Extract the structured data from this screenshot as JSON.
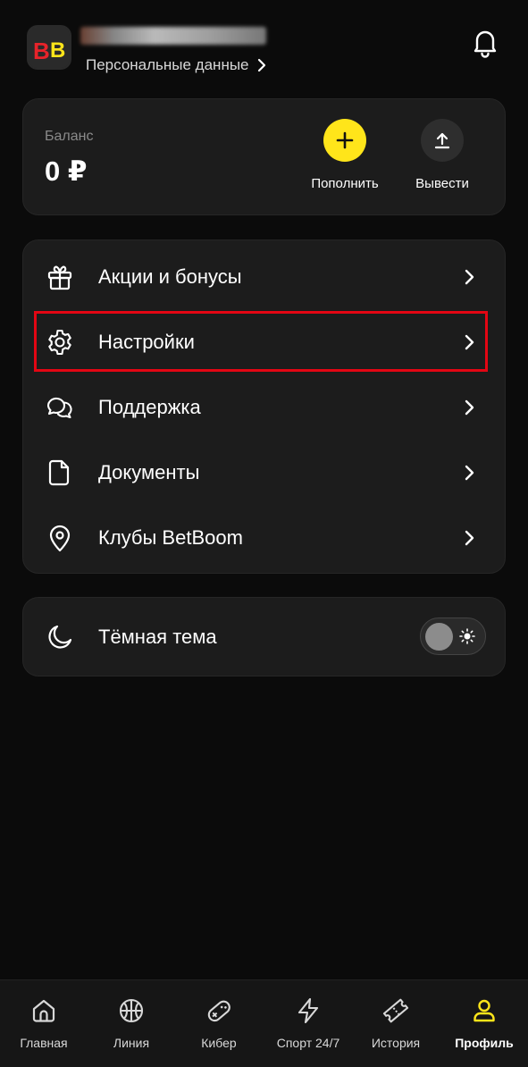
{
  "header": {
    "personal_link": "Персональные данные",
    "logo_text": "BB"
  },
  "balance": {
    "label": "Баланс",
    "value": "0 ₽",
    "deposit_label": "Пополнить",
    "withdraw_label": "Вывести"
  },
  "menu": {
    "items": [
      {
        "label": "Акции и бонусы",
        "icon": "gift-icon"
      },
      {
        "label": "Настройки",
        "icon": "gear-icon"
      },
      {
        "label": "Поддержка",
        "icon": "chat-icon"
      },
      {
        "label": "Документы",
        "icon": "document-icon"
      },
      {
        "label": "Клубы BetBoom",
        "icon": "location-pin-icon"
      }
    ]
  },
  "theme": {
    "label": "Тёмная тема",
    "enabled": false
  },
  "nav": {
    "items": [
      {
        "label": "Главная",
        "icon": "home-icon"
      },
      {
        "label": "Линия",
        "icon": "basketball-icon"
      },
      {
        "label": "Кибер",
        "icon": "gamepad-icon"
      },
      {
        "label": "Спорт 24/7",
        "icon": "lightning-icon"
      },
      {
        "label": "История",
        "icon": "ticket-icon"
      },
      {
        "label": "Профиль",
        "icon": "user-icon",
        "active": true
      }
    ]
  },
  "colors": {
    "accent": "#ffe51a",
    "highlight": "#e30613",
    "background": "#0b0b0b",
    "card": "#1c1c1c"
  }
}
